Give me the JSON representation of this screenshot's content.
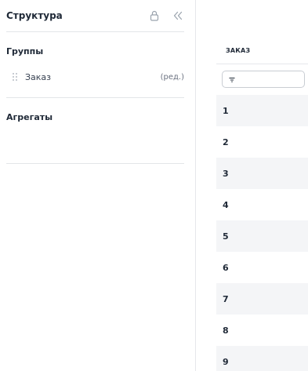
{
  "sidebar": {
    "title": "Структура",
    "lock_icon": "lock-icon",
    "collapse_icon": "double-chevron-left-icon",
    "groups": {
      "title": "Группы",
      "items": [
        {
          "label": "Заказ",
          "edit_label": "(ред.)"
        }
      ]
    },
    "aggregates": {
      "title": "Агрегаты"
    }
  },
  "table": {
    "column_header": "ЗАКАЗ",
    "filter": {
      "icon": "filter-icon",
      "value": ""
    },
    "rows": [
      "1",
      "2",
      "3",
      "4",
      "5",
      "6",
      "7",
      "8",
      "9"
    ]
  }
}
